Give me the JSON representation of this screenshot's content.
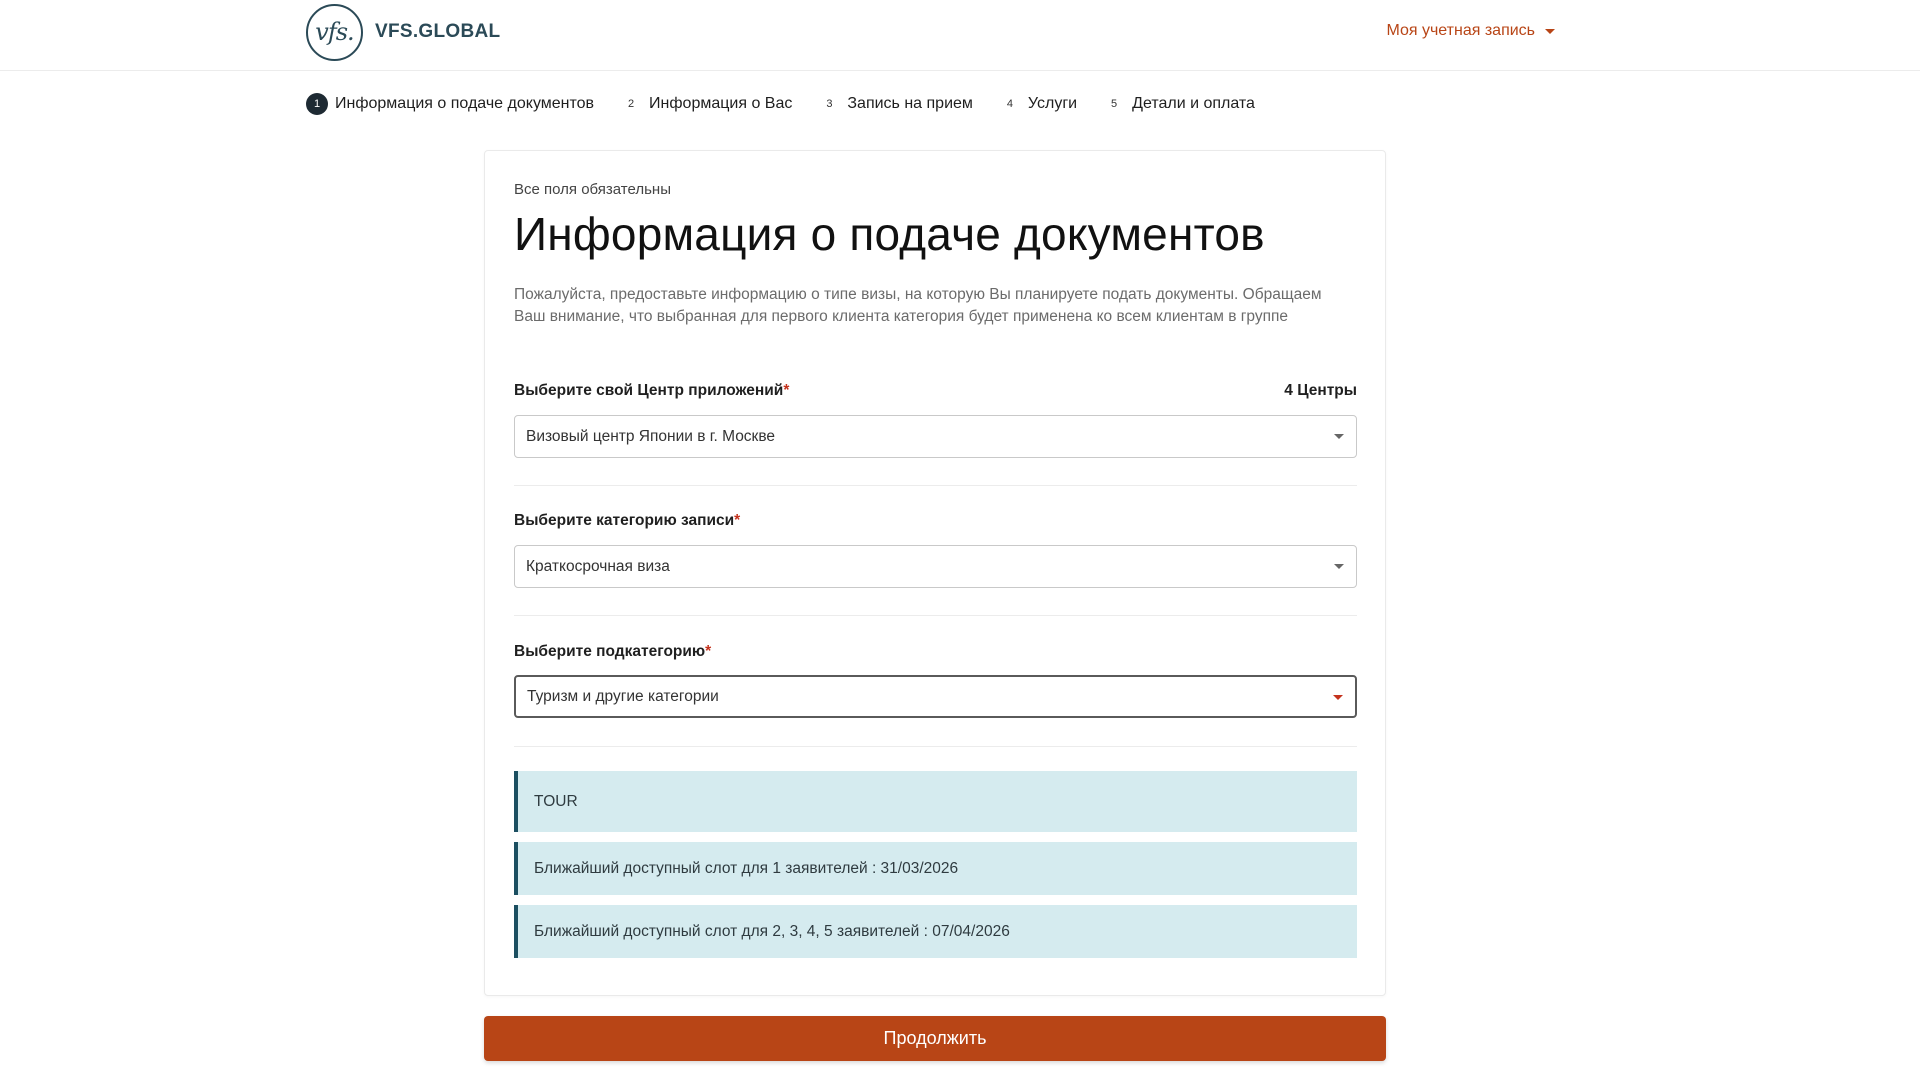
{
  "header": {
    "logo_mark": "vfs.",
    "logo_text": "VFS.GLOBAL",
    "account_label": "Моя учетная запись"
  },
  "stepper": [
    {
      "num": "1",
      "label": "Информация о подаче документов",
      "active": true
    },
    {
      "num": "2",
      "label": "Информация о Вас",
      "active": false
    },
    {
      "num": "3",
      "label": "Запись на прием",
      "active": false
    },
    {
      "num": "4",
      "label": "Услуги",
      "active": false
    },
    {
      "num": "5",
      "label": "Детали и оплата",
      "active": false
    }
  ],
  "form": {
    "required_note": "Все поля обязательны",
    "title": "Информация о подаче документов",
    "description": "Пожалуйста, предоставьте информацию о типе визы, на которую Вы планируете подать документы. Обращаем Ваш внимание, что выбранная для первого клиента категория будет применена ко всем клиентам в группе",
    "center_label": "Выберите свой Центр приложений",
    "center_count": "4 Центры",
    "center_value": "Визовый центр Японии в г. Москве",
    "category_label": "Выберите категорию записи",
    "category_value": "Краткосрочная виза",
    "subcategory_label": "Выберите подкатегорию",
    "subcategory_value": "Туризм и другие категории",
    "required_mark": "*"
  },
  "alerts": {
    "tour": "TOUR",
    "slot_one": "Ближайший доступный слот для 1 заявителей : 31/03/2026",
    "slot_group": "Ближайший доступный слот для 2, 3, 4, 5 заявителей : 07/04/2026"
  },
  "actions": {
    "continue_label": "Продолжить"
  },
  "colors": {
    "accent": "#b84516",
    "alert_bg": "#d5ebef",
    "alert_border": "#1c4f61",
    "brand": "#2b4a57"
  }
}
